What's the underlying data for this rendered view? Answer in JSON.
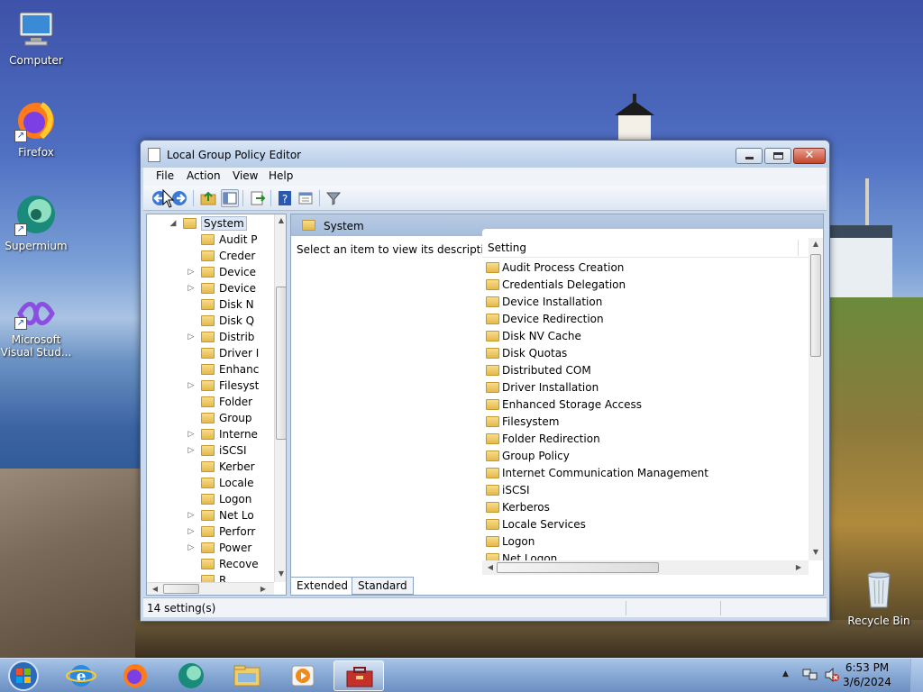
{
  "desktop": {
    "icons": [
      {
        "label": "Computer"
      },
      {
        "label": "Firefox"
      },
      {
        "label": "Supermium"
      },
      {
        "label": "Microsoft Visual Stud..."
      },
      {
        "label": "Recycle Bin"
      }
    ]
  },
  "window": {
    "title": "Local Group Policy Editor",
    "menu": [
      "File",
      "Action",
      "View",
      "Help"
    ],
    "tree": [
      {
        "label": "System",
        "expander": "◢",
        "selected": true
      },
      {
        "label": "Audit P",
        "expander": ""
      },
      {
        "label": "Creder",
        "expander": ""
      },
      {
        "label": "Device",
        "expander": "▷"
      },
      {
        "label": "Device",
        "expander": "▷"
      },
      {
        "label": "Disk N",
        "expander": ""
      },
      {
        "label": "Disk Q",
        "expander": ""
      },
      {
        "label": "Distrib",
        "expander": "▷"
      },
      {
        "label": "Driver I",
        "expander": ""
      },
      {
        "label": "Enhanc",
        "expander": ""
      },
      {
        "label": "Filesyst",
        "expander": "▷"
      },
      {
        "label": "Folder",
        "expander": ""
      },
      {
        "label": "Group",
        "expander": ""
      },
      {
        "label": "Interne",
        "expander": "▷"
      },
      {
        "label": "iSCSI",
        "expander": "▷"
      },
      {
        "label": "Kerber",
        "expander": ""
      },
      {
        "label": "Locale",
        "expander": ""
      },
      {
        "label": "Logon",
        "expander": ""
      },
      {
        "label": "Net Lo",
        "expander": "▷"
      },
      {
        "label": "Perforr",
        "expander": "▷"
      },
      {
        "label": "Power",
        "expander": "▷"
      },
      {
        "label": "Recove",
        "expander": ""
      },
      {
        "label": "R...",
        "expander": ""
      }
    ],
    "pane_header": "System",
    "description": "Select an item to view its description.",
    "column_header": "Setting",
    "settings": [
      "Audit Process Creation",
      "Credentials Delegation",
      "Device Installation",
      "Device Redirection",
      "Disk NV Cache",
      "Disk Quotas",
      "Distributed COM",
      "Driver Installation",
      "Enhanced Storage Access",
      "Filesystem",
      "Folder Redirection",
      "Group Policy",
      "Internet Communication Management",
      "iSCSI",
      "Kerberos",
      "Locale Services",
      "Logon",
      "Net Logon"
    ],
    "tabs": [
      "Extended",
      "Standard"
    ],
    "status": "14 setting(s)"
  },
  "taskbar": {
    "time": "6:53 PM",
    "date": "3/6/2024"
  },
  "colors": {
    "accent": "#1a4fb8",
    "folder": "#e6b94a",
    "close": "#c4452c"
  }
}
